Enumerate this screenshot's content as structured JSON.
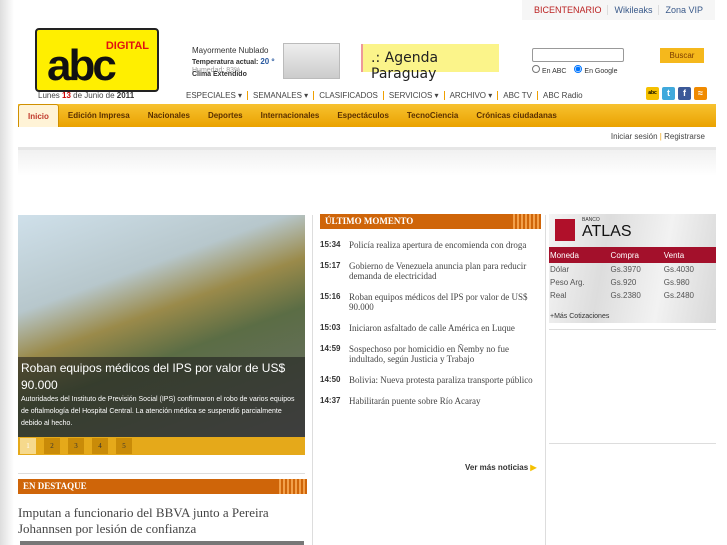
{
  "top_links": [
    "BICENTENARIO",
    "Wikileaks",
    "Zona VIP"
  ],
  "logo": {
    "digital": "DIGITAL",
    "abc": "abc"
  },
  "date": {
    "prefix": "Lunes",
    "day": "13",
    "middle": "de Junio de",
    "year": "2011"
  },
  "weather": {
    "condition": "Mayormente Nublado",
    "temp_label": "Temperatura actual:",
    "temp": "20 º",
    "humidity": "Humedad: 83%",
    "extended": "Clima Extendido"
  },
  "agenda": ".: Agenda Paraguay",
  "search": {
    "value": "",
    "options": [
      "En ABC",
      "En Google"
    ],
    "selected": "En Google",
    "button": "Buscar"
  },
  "menu": [
    "ESPECIALES ▾",
    "SEMANALES ▾",
    "CLASIFICADOS",
    "SERVICIOS ▾",
    "ARCHIVO ▾",
    "ABC TV",
    "ABC Radio"
  ],
  "nav": [
    "Inicio",
    "Edición Impresa",
    "Nacionales",
    "Deportes",
    "Internacionales",
    "Espectáculos",
    "TecnoCiencia",
    "Crónicas ciudadanas"
  ],
  "login": {
    "signin": "Iniciar sesión",
    "register": "Registrarse"
  },
  "slider": {
    "title": "Roban equipos médicos del IPS por valor de US$ 90.000",
    "summary": "Autoridades del Instituto de Previsión Social (IPS) confirmaron el robo de varios equipos de oftalmología del Hospital Central. La atención médica se suspendió parcialmente debido al hecho.",
    "pages": [
      "1",
      "2",
      "3",
      "4",
      "5"
    ],
    "current": "1"
  },
  "ultimo": {
    "title": "ÚLTIMO MOMENTO",
    "items": [
      {
        "time": "15:34",
        "headline": "Policía realiza apertura de encomienda con droga"
      },
      {
        "time": "15:17",
        "headline": "Gobierno de Venezuela anuncia plan para reducir demanda de electricidad"
      },
      {
        "time": "15:16",
        "headline": "Roban equipos médicos del IPS por valor de US$ 90.000"
      },
      {
        "time": "15:03",
        "headline": "Iniciaron asfaltado de calle América en Luque"
      },
      {
        "time": "14:59",
        "headline": "Sospechoso por homicidio en Ñemby no fue indultado, según Justicia y Trabajo"
      },
      {
        "time": "14:50",
        "headline": "Bolivia: Nueva protesta paraliza transporte público"
      },
      {
        "time": "14:37",
        "headline": "Habilitarán puente sobre Río Acaray"
      }
    ],
    "more": "Ver más noticias"
  },
  "atlas": {
    "bank": "BANCO",
    "name": "ATLAS",
    "headers": [
      "Moneda",
      "Compra",
      "Venta"
    ],
    "rows": [
      [
        "Dólar",
        "Gs.3970",
        "Gs.4030"
      ],
      [
        "Peso Arg.",
        "Gs.920",
        "Gs.980"
      ],
      [
        "Real",
        "Gs.2380",
        "Gs.2480"
      ]
    ],
    "more": "+Más Cotizaciones"
  },
  "destaque": {
    "title": "EN DESTAQUE",
    "headline": "Imputan a funcionario del BBVA junto a Pereira Johannsen por lesión de confianza"
  }
}
